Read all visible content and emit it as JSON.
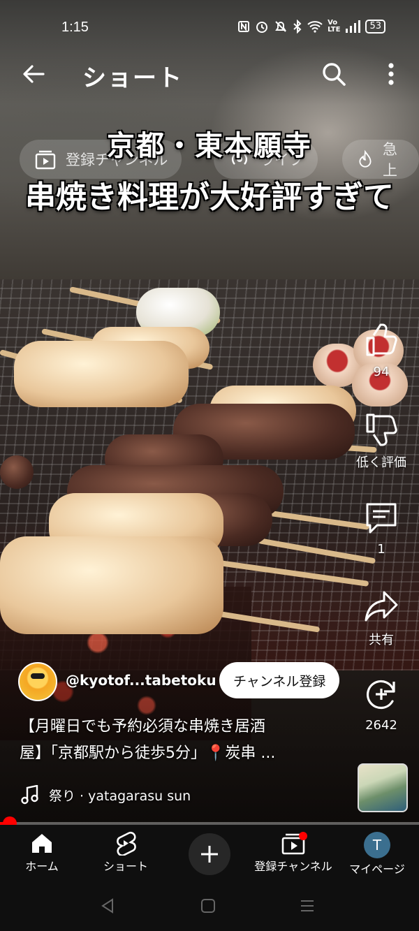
{
  "status_bar": {
    "time": "1:15",
    "icons": [
      "nfc-icon",
      "alarm-icon",
      "mute-icon",
      "bluetooth-icon",
      "wifi-icon",
      "volte-icon",
      "signal-icon"
    ],
    "battery": "53"
  },
  "top_bar": {
    "title": "ショート"
  },
  "filter_chips": [
    {
      "label": "登録チャンネル",
      "icon": "subscriptions-icon"
    },
    {
      "label": "ライブ",
      "icon": "live-icon"
    },
    {
      "label": "急上",
      "icon": "trending-icon"
    }
  ],
  "video_caption": {
    "line1": "京都・東本願寺",
    "line2": "串焼き料理が大好評すぎて"
  },
  "actions": {
    "like_count": "94",
    "dislike_label": "低く評価",
    "comment_count": "1",
    "share_label": "共有",
    "remix_count": "2642"
  },
  "channel": {
    "handle": "@kyotof...tabetoku",
    "subscribe_label": "チャンネル登録"
  },
  "description": {
    "line1": "【月曜日でも予約必須な串焼き居酒",
    "line2": "屋】「京都駅から徒歩5分」📍炭串 ..."
  },
  "music": {
    "label": "祭り · yatagarasu sun"
  },
  "progress": {
    "fraction": 0.01
  },
  "bottom_nav": {
    "home": "ホーム",
    "shorts": "ショート",
    "subscriptions": "登録チャンネル",
    "mypage": "マイページ",
    "avatar_letter": "T"
  },
  "colors": {
    "accent": "#ff0000",
    "nav_background": "#0f0f0f",
    "subscribe_button": "#ffffff"
  }
}
